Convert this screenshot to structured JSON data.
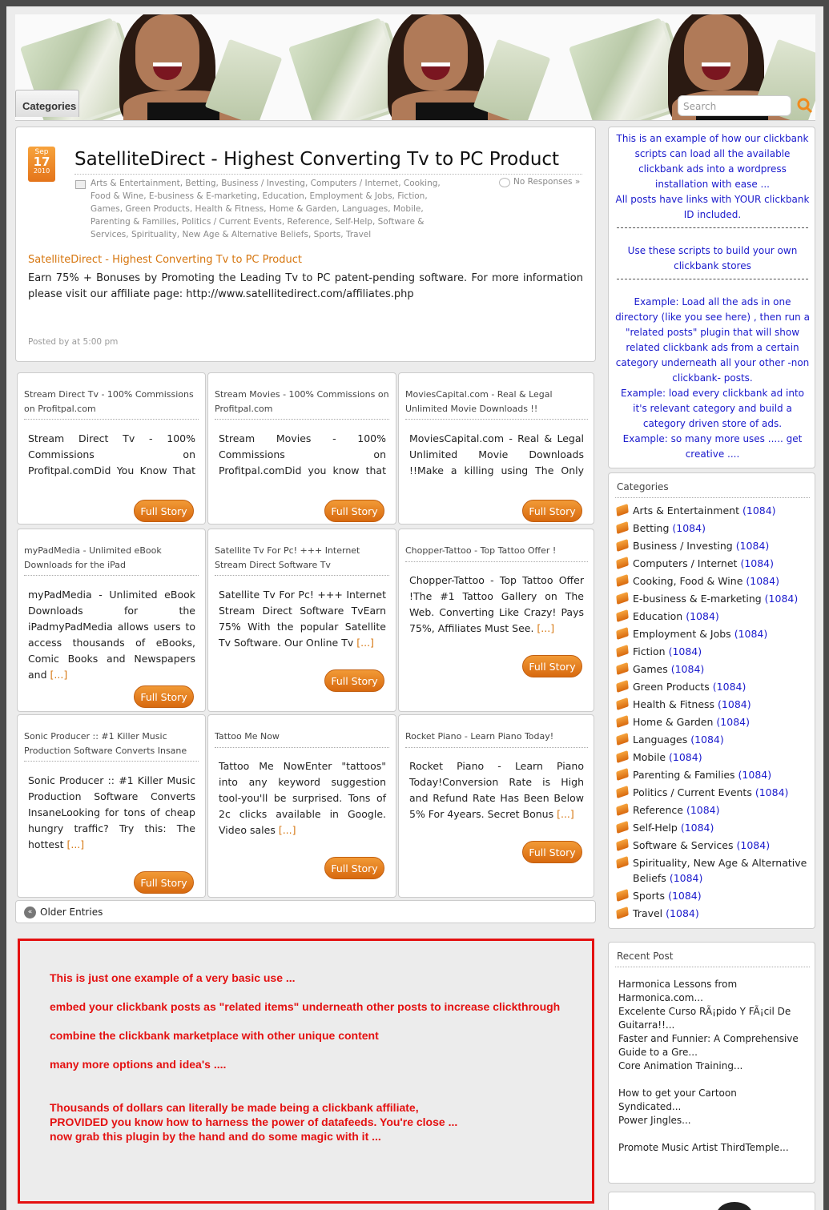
{
  "header": {
    "categories_tab": "Categories",
    "search_placeholder": "Search"
  },
  "featured": {
    "date": {
      "month": "Sep",
      "day": "17",
      "year": "2010"
    },
    "title": "SatelliteDirect - Highest Converting Tv to PC Product",
    "categories": "Arts & Entertainment, Betting, Business / Investing, Computers / Internet, Cooking, Food & Wine, E-business & E-marketing, Education, Employment & Jobs, Fiction, Games, Green Products, Health & Fitness, Home & Garden, Languages, Mobile, Parenting & Families, Politics / Current Events, Reference, Self-Help, Software & Services, Spirituality, New Age & Alternative Beliefs, Sports, Travel",
    "responses": "No Responses »",
    "subtitle": "SatelliteDirect - Highest Converting Tv to PC Product",
    "body": "Earn 75% + Bonuses by Promoting the Leading Tv to PC patent-pending software. For more information please visit our affiliate page: http://www.satellitedirect.com/affiliates.php",
    "posted_by": "Posted by at 5:00 pm"
  },
  "cards": [
    {
      "title": "Stream Direct Tv - 100% Commissions on Profitpal.com",
      "body": "Stream Direct Tv - 100% Commissions on Profitpal.comDid You Know That For A Limited Time",
      "more": "[...]",
      "button": "Full Story"
    },
    {
      "title": "Stream Movies - 100% Commissions on Profitpal.com",
      "body": "Stream Movies - 100% Commissions on Profitpal.comDid you know that for a limited time",
      "more": "[...]",
      "button": "Full Story"
    },
    {
      "title": "MoviesCapital.com - Real & Legal Unlimited Movie Downloads !!",
      "body": "MoviesCapital.com - Real & Legal Unlimited Movie Downloads !!Make a killing using The Only Legal & Real",
      "more": "[...]",
      "button": "Full Story"
    },
    {
      "title": "myPadMedia - Unlimited eBook Downloads for the iPad",
      "body": "myPadMedia - Unlimited eBook Downloads for the iPadmyPadMedia allows users to access thousands of eBooks, Comic Books and Newspapers and",
      "more": "[...]",
      "button": "Full Story"
    },
    {
      "title": "Satellite Tv For Pc! +++ Internet Stream Direct Software Tv",
      "body": "Satellite Tv For Pc! +++ Internet Stream Direct Software TvEarn 75% With the popular Satellite Tv Software. Our Online Tv",
      "more": "[...]",
      "button": "Full Story"
    },
    {
      "title": "Chopper-Tattoo - Top Tattoo Offer !",
      "body": "Chopper-Tattoo - Top Tattoo Offer !The #1 Tattoo Gallery on The Web. Converting Like Crazy! Pays 75%, Affiliates Must See.",
      "more": "[...]",
      "button": "Full Story"
    },
    {
      "title": "Sonic Producer :: #1 Killer Music Production Software Converts Insane",
      "body": "Sonic Producer :: #1 Killer Music Production Software Converts InsaneLooking for tons of cheap hungry traffic? Try this: The hottest",
      "more": "[...]",
      "button": "Full Story"
    },
    {
      "title": "Tattoo Me Now",
      "body": "Tattoo Me NowEnter \"tattoos\" into any keyword suggestion tool-you'll be surprised. Tons of 2c clicks available in Google. Video sales",
      "more": "[...]",
      "button": "Full Story"
    },
    {
      "title": "Rocket Piano - Learn Piano Today!",
      "body": "Rocket Piano - Learn Piano Today!Conversion Rate is High and Refund Rate Has Been Below 5% For 4years. Secret Bonus",
      "more": "[...]",
      "button": "Full Story"
    }
  ],
  "older_entries": "Older Entries",
  "promo": {
    "l1": "This is just one example of a very basic use ...",
    "l2": "embed your clickbank posts as \"related items\" underneath other posts to increase clickthrough",
    "l3": "combine the clickbank marketplace with other unique content",
    "l4": "many more options and idea's ....",
    "l5": "Thousands of dollars can literally be made being a clickbank affiliate,",
    "l6": "PROVIDED you know how to harness the power of datafeeds. You're close ...",
    "l7": "now grab this plugin by the hand and do some magic with it ..."
  },
  "info": {
    "p1": "This is an example of how our clickbank scripts can load all the available clickbank ads into a wordpress installation with ease ...",
    "p2": "All posts have links with YOUR clickbank ID included.",
    "p3_pre": "Use these scripts ",
    "p3_link": "to build your own clickbank stores",
    "p4": "Example: Load all the ads in one directory (like you see here) , then run a \"related posts\" plugin that will show related clickbank ads from a certain category underneath all your other -non clickbank- posts.",
    "p5": "Example: load every clickbank ad into it's relevant category and build a category driven store of ads.",
    "p6": "Example: so many more uses ..... get creative ...."
  },
  "sidebar_categories": {
    "heading": "Categories",
    "items": [
      {
        "name": "Arts & Entertainment",
        "count": "(1084)"
      },
      {
        "name": "Betting",
        "count": "(1084)"
      },
      {
        "name": "Business / Investing",
        "count": "(1084)"
      },
      {
        "name": "Computers / Internet",
        "count": "(1084)"
      },
      {
        "name": "Cooking, Food & Wine",
        "count": "(1084)"
      },
      {
        "name": "E-business & E-marketing",
        "count": "(1084)"
      },
      {
        "name": "Education",
        "count": "(1084)"
      },
      {
        "name": "Employment & Jobs",
        "count": "(1084)"
      },
      {
        "name": "Fiction",
        "count": "(1084)"
      },
      {
        "name": "Games",
        "count": "(1084)"
      },
      {
        "name": "Green Products",
        "count": "(1084)"
      },
      {
        "name": "Health & Fitness",
        "count": "(1084)"
      },
      {
        "name": "Home & Garden",
        "count": "(1084)"
      },
      {
        "name": "Languages",
        "count": "(1084)"
      },
      {
        "name": "Mobile",
        "count": "(1084)"
      },
      {
        "name": "Parenting & Families",
        "count": "(1084)"
      },
      {
        "name": "Politics / Current Events",
        "count": "(1084)"
      },
      {
        "name": "Reference",
        "count": "(1084)"
      },
      {
        "name": "Self-Help",
        "count": "(1084)"
      },
      {
        "name": "Software & Services",
        "count": "(1084)"
      },
      {
        "name": "Spirituality, New Age & Alternative Beliefs",
        "count": "(1084)"
      },
      {
        "name": "Sports",
        "count": "(1084)"
      },
      {
        "name": "Travel",
        "count": "(1084)"
      }
    ]
  },
  "recent": {
    "heading": "Recent Post",
    "items": [
      "Harmonica Lessons from Harmonica.com...",
      "Excelente Curso RÃ¡pido Y FÃ¡cil De Guitarra!!...",
      "Faster and Funnier: A Comprehensive Guide to a Gre...",
      "Core Animation Training...",
      "How to get your Cartoon Syndicated...",
      "Power Jingles...",
      "Promote Music Artist ThirdTemple..."
    ]
  }
}
